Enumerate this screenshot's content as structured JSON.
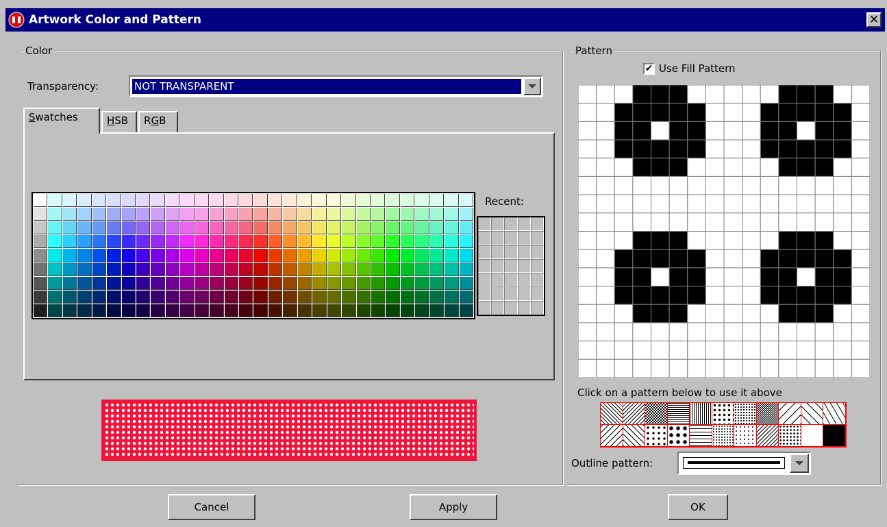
{
  "window": {
    "title": "Artwork Color and Pattern",
    "close_glyph": "✕"
  },
  "color_group": {
    "legend": "Color",
    "transparency_label": "Transparency:",
    "transparency_value": "NOT TRANSPARENT",
    "tabs": [
      {
        "key": "S",
        "rest": "watches",
        "selected": true
      },
      {
        "key": "H",
        "rest": "SB",
        "selected": false
      },
      {
        "pre": "R",
        "key": "G",
        "rest": "B",
        "selected": false
      }
    ],
    "recent_label": "Recent:",
    "preview_color": "#f0143c"
  },
  "pattern_group": {
    "legend": "Pattern",
    "use_fill_label": "Use Fill Pattern",
    "use_fill_checked": true,
    "check_glyph": "✔",
    "hint": "Click on a pattern below to use it above",
    "outline_label": "Outline pattern:"
  },
  "buttons": {
    "cancel": "Cancel",
    "apply": "Apply",
    "ok": "OK"
  }
}
